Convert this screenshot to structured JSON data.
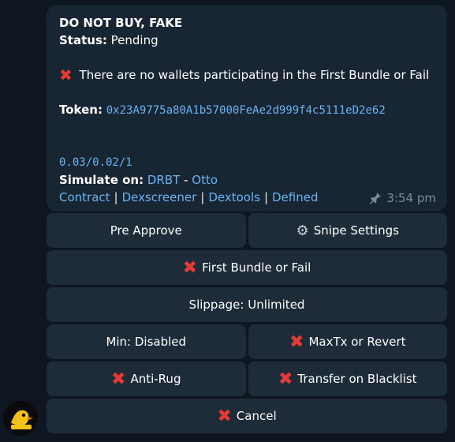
{
  "message": {
    "title": "DO NOT BUY, FAKE",
    "status_label": "Status:",
    "status_value": "Pending",
    "warning": "There are no wallets participating in the First Bundle or Fail",
    "token_label": "Token:",
    "token_address": "0x23A9775a80A1b57000FeAe2d999f4c5111eD2e62",
    "fees": "0.03/0.02/1",
    "simulate_label": "Simulate on:",
    "simulate_a": "DRBT",
    "simulate_dash": "-",
    "simulate_b": "Otto",
    "links": [
      "Contract",
      "Dexscreener",
      "Dextools",
      "Defined"
    ],
    "time": "3:54 pm"
  },
  "keyboard": {
    "pre_approve": "Pre Approve",
    "snipe_settings": "Snipe Settings",
    "first_bundle": "First Bundle or Fail",
    "slippage": "Slippage: Unlimited",
    "min": "Min: Disabled",
    "maxtx": "MaxTx or Revert",
    "anti_rug": "Anti-Rug",
    "transfer_blacklist": "Transfer on Blacklist",
    "cancel": "Cancel"
  },
  "colors": {
    "background": "#0e1621",
    "bubble": "#182533",
    "button": "#1e2c3a",
    "link": "#6ab3f3",
    "cross": "#e53935",
    "timestamp": "#7d8b99"
  },
  "icons": [
    "cross-mark-icon",
    "gear-icon",
    "pin-icon",
    "avatar-logo"
  ]
}
